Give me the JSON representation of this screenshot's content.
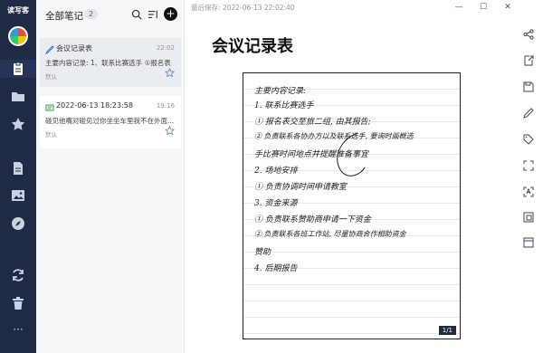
{
  "nav": {
    "brand": "读写客",
    "items": [
      "notes-icon",
      "folder-icon",
      "star-icon",
      "document-icon",
      "image-icon",
      "compass-icon",
      "sync-icon",
      "trash-icon",
      "more-icon"
    ],
    "more_glyph": "···"
  },
  "list": {
    "title": "全部笔记",
    "count": "2",
    "add_glyph": "+",
    "cards": [
      {
        "title": "会议记录表",
        "time": "22:02",
        "snippet": "主要内容记录: 1、联系比赛选手 ①报名表",
        "tag": "默认",
        "icon": "handwriting-icon"
      },
      {
        "title": "2022-06-13 18:23:58",
        "time": "19:16",
        "snippet": "碰见他嘴对碰见过你坐坐车里我不在外面...",
        "tag": "默认",
        "icon": "note-icon"
      }
    ]
  },
  "editor": {
    "saved": "最后保存: 2022-06-13 22:02:40",
    "title": "会议记录表",
    "page": "1/1",
    "handwriting": [
      "主要内容记录:",
      "1. 联系比赛选手",
      "① 报名表交至旅二组, 由其报告;",
      "② 负责联系各协办方以及联系选手, 要询时画概选",
      "手比赛时间地点并提醒准备事宜",
      "2. 场地安排",
      "① 负责协调时间申请教室",
      "3. 资金来源",
      "① 负责联系赞助商申请一下资金",
      "② 负责联系各班工作站, 尽量协商合作相助资金",
      "赞助",
      "4. 后期报告"
    ]
  },
  "window": {
    "minimize": "—",
    "maximize": "☐",
    "close": "✕"
  },
  "toolbar": [
    "share-icon",
    "export-icon",
    "save-icon",
    "pen-icon",
    "tag-icon",
    "fullscreen-icon",
    "ocr-icon",
    "crop-icon",
    "layout-icon"
  ]
}
